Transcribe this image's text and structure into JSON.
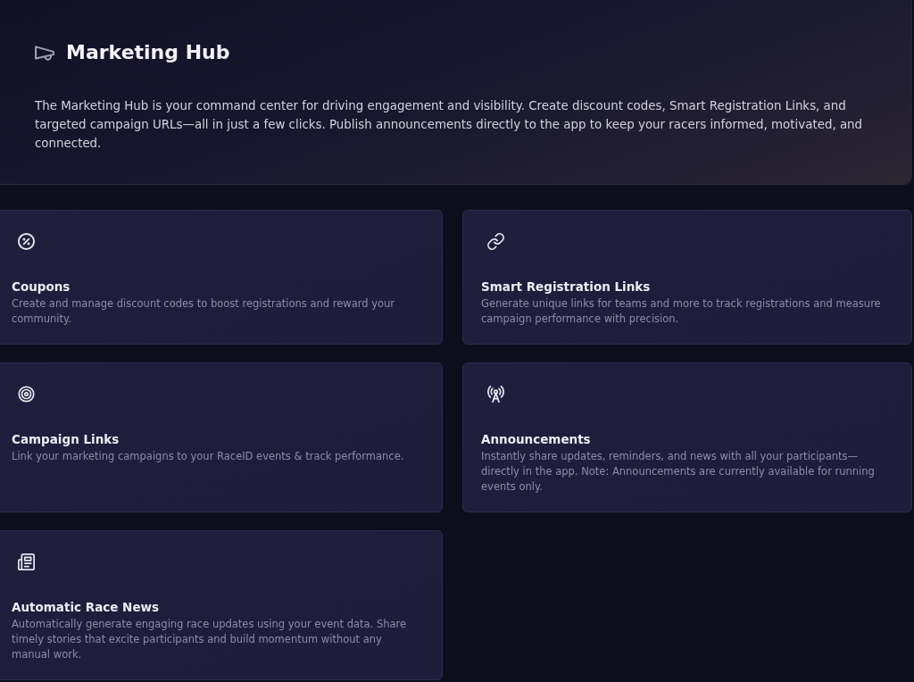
{
  "header": {
    "title": "Marketing Hub",
    "description": "The Marketing Hub is your command center for driving engagement and visibility. Create discount codes, Smart Registration Links, and targeted campaign URLs—all in just a few clicks. Publish announcements directly to the app to keep your racers informed, motivated, and connected."
  },
  "cards": [
    {
      "title": "Coupons",
      "description": "Create and manage discount codes to boost registrations and reward your community."
    },
    {
      "title": "Smart Registration Links",
      "description": "Generate unique links for teams and more to track registrations and measure campaign performance with precision."
    },
    {
      "title": "Campaign Links",
      "description": "Link your marketing campaigns to your RaceID events & track performance."
    },
    {
      "title": "Announcements",
      "description": "Instantly share updates, reminders, and news with all your participants—directly in the app. Note: Announcements are currently available for running events only."
    },
    {
      "title": "Automatic Race News",
      "description": "Automatically generate engaging race updates using your event data. Share timely stories that excite participants and build momentum without any manual work."
    }
  ]
}
